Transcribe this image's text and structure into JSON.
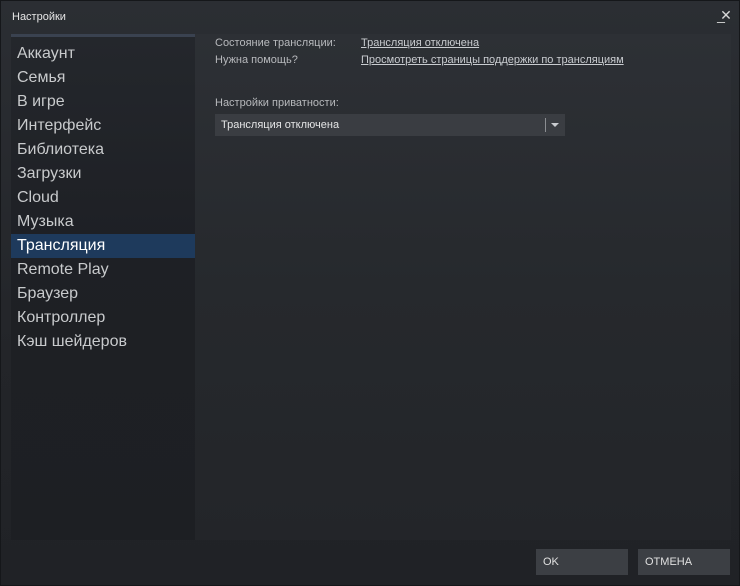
{
  "window": {
    "title": "Настройки",
    "minimize_glyph": "_",
    "close_glyph": "✕"
  },
  "sidebar": {
    "items": [
      {
        "label": "Аккаунт",
        "active": false
      },
      {
        "label": "Семья",
        "active": false
      },
      {
        "label": "В игре",
        "active": false
      },
      {
        "label": "Интерфейс",
        "active": false
      },
      {
        "label": "Библиотека",
        "active": false
      },
      {
        "label": "Загрузки",
        "active": false
      },
      {
        "label": "Cloud",
        "active": false
      },
      {
        "label": "Музыка",
        "active": false
      },
      {
        "label": "Трансляция",
        "active": true
      },
      {
        "label": "Remote Play",
        "active": false
      },
      {
        "label": "Браузер",
        "active": false
      },
      {
        "label": "Контроллер",
        "active": false
      },
      {
        "label": "Кэш шейдеров",
        "active": false
      }
    ]
  },
  "main": {
    "status_label": "Состояние трансляции:",
    "status_value": "Трансляция отключена",
    "help_label": "Нужна помощь?",
    "help_link": "Просмотреть страницы поддержки по трансляциям",
    "privacy_label": "Настройки приватности:",
    "privacy_selected": "Трансляция отключена"
  },
  "buttons": {
    "ok": "OK",
    "cancel": "ОТМЕНА"
  },
  "colors": {
    "active_item": "#1e3a5c",
    "text": "#c8cacc"
  }
}
